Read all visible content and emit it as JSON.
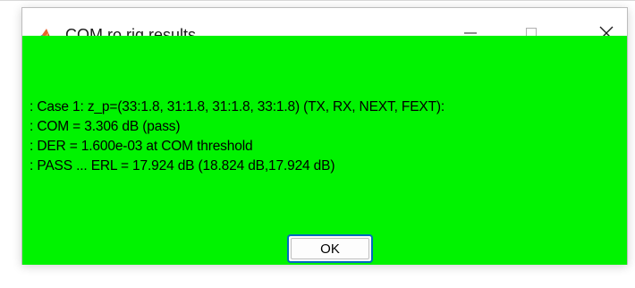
{
  "window": {
    "title": "COM ro.rig results",
    "icon": "matlab-logo-icon",
    "controls": {
      "minimize_icon": "minimize-icon",
      "maximize_icon": "maximize-icon",
      "close_icon": "close-icon"
    }
  },
  "content": {
    "background_color": "#00f300",
    "lines": [
      ": Case 1: z_p=(33:1.8, 31:1.8, 31:1.8, 33:1.8) (TX, RX, NEXT, FEXT):",
      ": COM = 3.306 dB (pass)",
      ": DER = 1.600e-03 at COM threshold",
      ": PASS ... ERL = 17.924 dB (18.824 dB,17.924 dB)"
    ]
  },
  "buttons": {
    "ok_label": "OK"
  }
}
